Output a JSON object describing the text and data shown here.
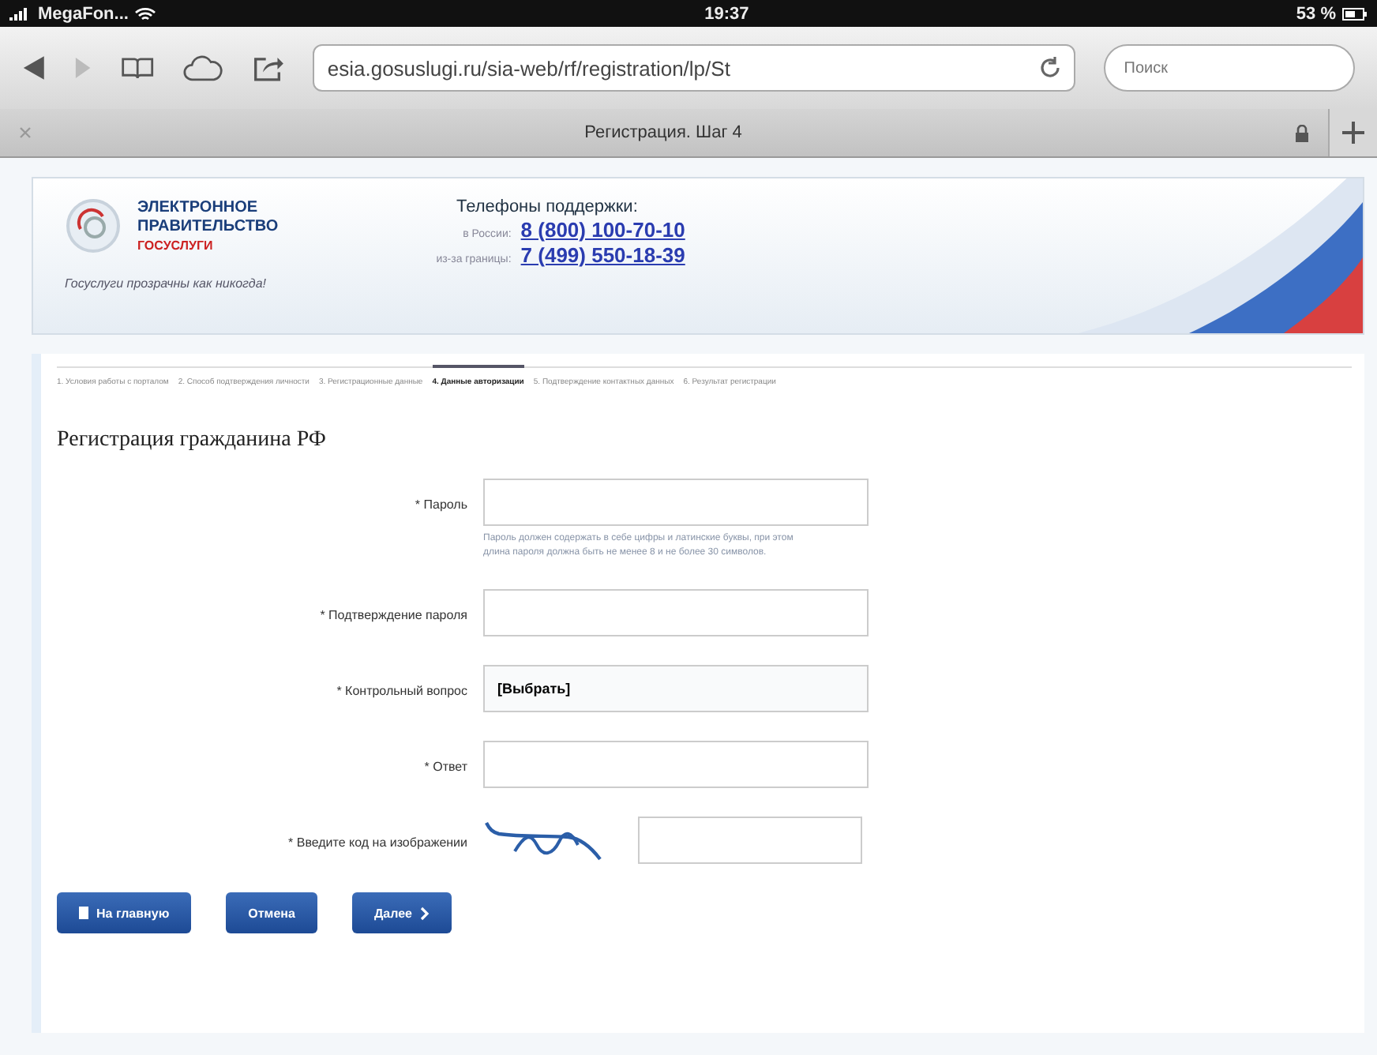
{
  "status_bar": {
    "carrier": "MegaFon...",
    "time": "19:37",
    "battery": "53 %"
  },
  "browser": {
    "url": "esia.gosuslugi.ru/sia-web/rf/registration/lp/St",
    "search": {
      "placeholder": "Поиск"
    },
    "tab_title": "Регистрация. Шаг 4"
  },
  "header": {
    "logo_lines": [
      "ЭЛЕКТРОННОЕ",
      "ПРАВИТЕЛЬСТВО"
    ],
    "logo_sub": "ГОСУСЛУГИ",
    "tagline": "Госуслуги прозрачны как никогда!",
    "support_title": "Телефоны поддержки:",
    "phones": [
      {
        "label": "в России:",
        "number": "8 (800) 100-70-10"
      },
      {
        "label": "из-за границы:",
        "number": "7 (499) 550-18-39"
      }
    ]
  },
  "steps": [
    {
      "label": "1. Условия работы с порталом",
      "selected": false
    },
    {
      "label": "2. Способ подтверждения личности",
      "selected": false
    },
    {
      "label": "3. Регистрационные данные",
      "selected": false
    },
    {
      "label": "4. Данные авторизации",
      "selected": true
    },
    {
      "label": "5. Подтверждение контактных данных",
      "selected": false
    },
    {
      "label": "6. Результат регистрации",
      "selected": false
    }
  ],
  "form": {
    "title": "Регистрация гражданина РФ",
    "fields": [
      {
        "kind": "text",
        "label": "* Пароль",
        "hint": "Пароль должен содержать в себе цифры и латинские буквы, при этом длина пароля должна быть не менее 8 и не более 30 символов."
      },
      {
        "kind": "text",
        "label": "* Подтверждение пароля"
      },
      {
        "kind": "select",
        "label": "* Контрольный вопрос",
        "value": "[Выбрать]"
      },
      {
        "kind": "text",
        "label": "* Ответ"
      },
      {
        "kind": "captcha",
        "label": "* Введите код на изображении"
      }
    ]
  },
  "buttons": [
    {
      "label": "На главную",
      "kind": "home"
    },
    {
      "label": "Отмена",
      "kind": "plain"
    },
    {
      "label": "Далее",
      "kind": "next"
    }
  ]
}
